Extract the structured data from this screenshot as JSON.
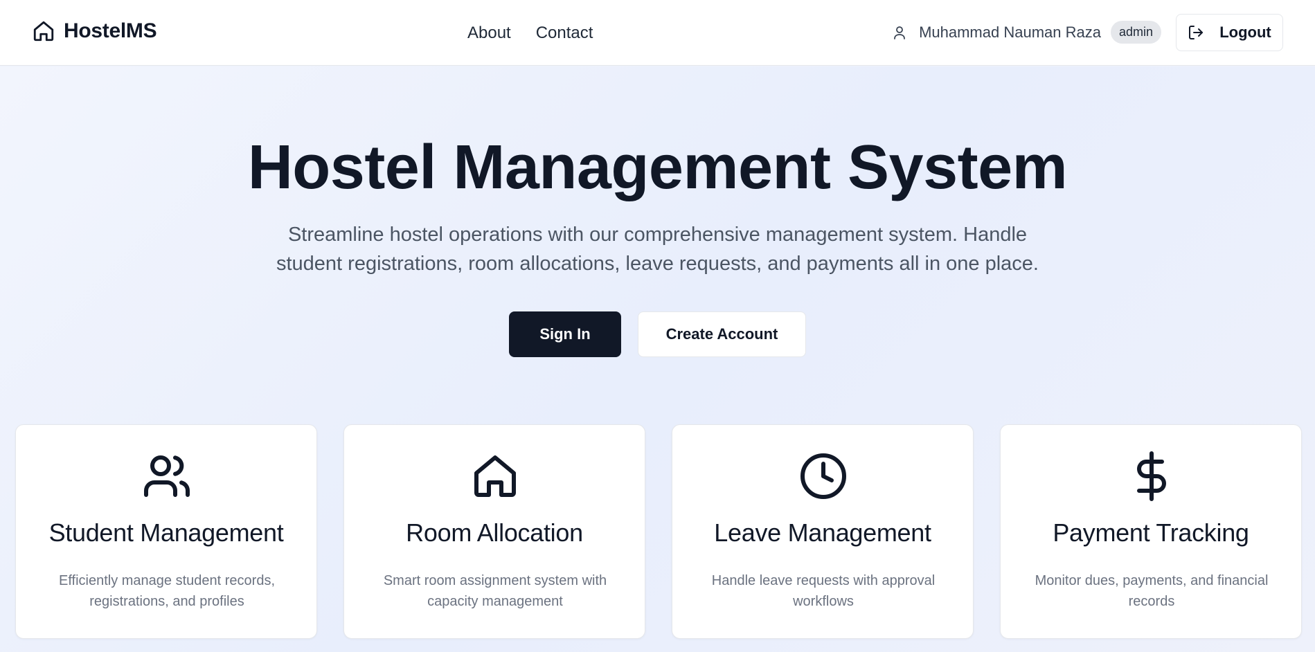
{
  "navbar": {
    "brand": "HostelMS",
    "links": [
      "About",
      "Contact"
    ],
    "user_name": "Muhammad Nauman Raza",
    "role": "admin",
    "logout_label": "Logout"
  },
  "hero": {
    "title": "Hostel Management System",
    "subtitle": "Streamline hostel operations with our comprehensive management system. Handle student registrations, room allocations, leave requests, and payments all in one place.",
    "primary_button": "Sign In",
    "secondary_button": "Create Account"
  },
  "features": [
    {
      "icon": "users-icon",
      "title": "Student Management",
      "description": "Efficiently manage student records, registrations, and profiles"
    },
    {
      "icon": "home-icon",
      "title": "Room Allocation",
      "description": "Smart room assignment system with capacity management"
    },
    {
      "icon": "clock-icon",
      "title": "Leave Management",
      "description": "Handle leave requests with approval workflows"
    },
    {
      "icon": "dollar-icon",
      "title": "Payment Tracking",
      "description": "Monitor dues, payments, and financial records"
    }
  ],
  "colors": {
    "primary": "#111827",
    "background": "#eef2fc",
    "muted_text": "#6b7280",
    "badge_bg": "#e5e7eb"
  }
}
